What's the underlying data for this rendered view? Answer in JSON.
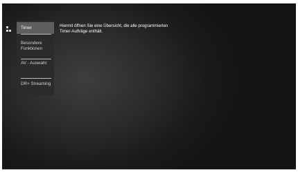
{
  "menu": {
    "items": [
      {
        "label": "Timer",
        "selected": true
      },
      {
        "label": "Besondere Funktionen",
        "selected": false
      },
      {
        "label": "AV - Auswahl",
        "selected": false
      },
      {
        "label": "DR+ Streaming",
        "selected": false
      }
    ]
  },
  "tooltip": {
    "line1": "Hiermit öffnen Sie eine Übersicht, die alle programmierten",
    "line2": "Timer-Aufträge enthält."
  },
  "colors": {
    "background": "#1c1c1c",
    "panel": "#2b2b2b",
    "selected": "#5f5f5f",
    "text": "#ffffff"
  },
  "icons": {
    "nav_indicator": "grid-dots-icon"
  }
}
